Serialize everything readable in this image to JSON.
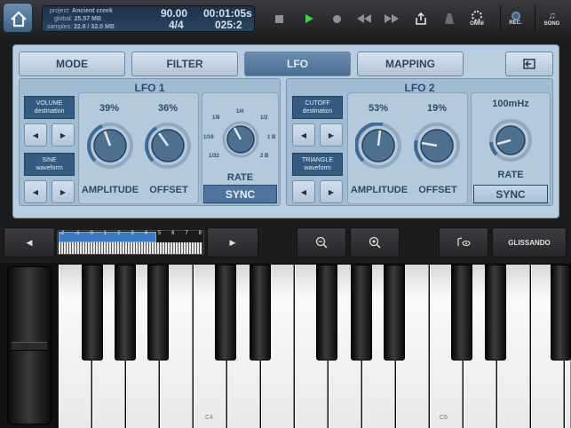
{
  "top": {
    "project_label": "project:",
    "project_value": "Ancient creek",
    "global_label": "global:",
    "global_value": "25.57 MB",
    "samples_label": "samples:",
    "samples_value": "22.8 / 32.0 MB",
    "tempo": "90.00",
    "time_sig": "4/4",
    "time": "00:01:05s",
    "position": "025:2",
    "omni_label": "OMNI",
    "rec_label": "REC.",
    "song_label": "SONG"
  },
  "tabs": [
    "MODE",
    "FILTER",
    "LFO",
    "MAPPING"
  ],
  "lfo1": {
    "title": "LFO 1",
    "dest_label": "VOLUME",
    "dest_sub": "destination",
    "wave_label": "SINE",
    "wave_sub": "waveform",
    "amplitude_value": "39%",
    "offset_value": "36%",
    "amplitude_label": "AMPLITUDE",
    "offset_label": "OFFSET",
    "rate_label": "RATE",
    "sync_label": "SYNC",
    "rate_ticks": [
      "1/4",
      "1/8",
      "1/2",
      "1/16",
      "1 B",
      "1/32",
      "2 B"
    ]
  },
  "lfo2": {
    "title": "LFO 2",
    "dest_label": "CUTOFF",
    "dest_sub": "destination",
    "wave_label": "TRIANGLE",
    "wave_sub": "waveform",
    "amplitude_value": "53%",
    "offset_value": "19%",
    "amplitude_label": "AMPLITUDE",
    "offset_label": "OFFSET",
    "rate_value": "100mHz",
    "rate_label": "RATE",
    "sync_label": "SYNC"
  },
  "nav": {
    "octaves": [
      "-2",
      "-1",
      "0",
      "1",
      "2",
      "3",
      "4",
      "5",
      "6",
      "7",
      "8"
    ],
    "glissando_label": "GLISSANDO"
  },
  "keyboard": {
    "c4_label": "C4",
    "c5_label": "C5"
  }
}
